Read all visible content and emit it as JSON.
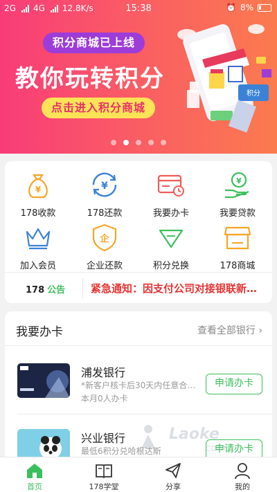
{
  "status_bar": {
    "net1": "2G",
    "net2": "4G",
    "speed": "12.8K/s",
    "time": "15:38",
    "battery": "8%"
  },
  "banner": {
    "tag": "积分商城已上线",
    "headline": "教你玩转积分",
    "cta": "点击进入积分商城",
    "art_tag": "积分",
    "slides": 5,
    "active_slide": 2
  },
  "grid": {
    "items": [
      {
        "label": "178收款",
        "icon": "money-bag-icon"
      },
      {
        "label": "178还款",
        "icon": "yen-refresh-icon"
      },
      {
        "label": "我要办卡",
        "icon": "card-clock-icon"
      },
      {
        "label": "我要贷款",
        "icon": "loan-hand-icon"
      },
      {
        "label": "加入会员",
        "icon": "crown-icon"
      },
      {
        "label": "企业还款",
        "icon": "enterprise-shield-icon"
      },
      {
        "label": "积分兑换",
        "icon": "diamond-icon"
      },
      {
        "label": "178商城",
        "icon": "shop-icon"
      }
    ]
  },
  "notice": {
    "brand": "178",
    "brand_suffix": "公告",
    "message": "紧急通知：因支付公司对接银联新…"
  },
  "cards": {
    "title": "我要办卡",
    "more": "查看全部银行",
    "banks": [
      {
        "name": "浦发银行",
        "desc": "*新客户核卡后30天内任意合…",
        "count": "本月0人办卡",
        "apply": "申请办卡"
      },
      {
        "name": "兴业银行",
        "desc": "最低6积分兑哈根达斯",
        "count": "",
        "apply": "申请办卡"
      }
    ]
  },
  "watermark": {
    "text": "Laoke",
    "sub": ".com"
  },
  "tabbar": {
    "tabs": [
      {
        "label": "首页",
        "icon": "home-icon",
        "active": true
      },
      {
        "label": "178学堂",
        "icon": "book-icon",
        "active": false
      },
      {
        "label": "分享",
        "icon": "paper-plane-icon",
        "active": false
      },
      {
        "label": "我的",
        "icon": "user-icon",
        "active": false
      }
    ]
  },
  "colors": {
    "accent": "#3bbf5d",
    "alert": "#e53333",
    "banner_start": "#f83c78",
    "banner_end": "#fb7b4e",
    "icon_orange": "#f5a623",
    "icon_blue": "#3b82d6",
    "icon_red": "#ef5b5b",
    "icon_green": "#3bbf5d"
  }
}
